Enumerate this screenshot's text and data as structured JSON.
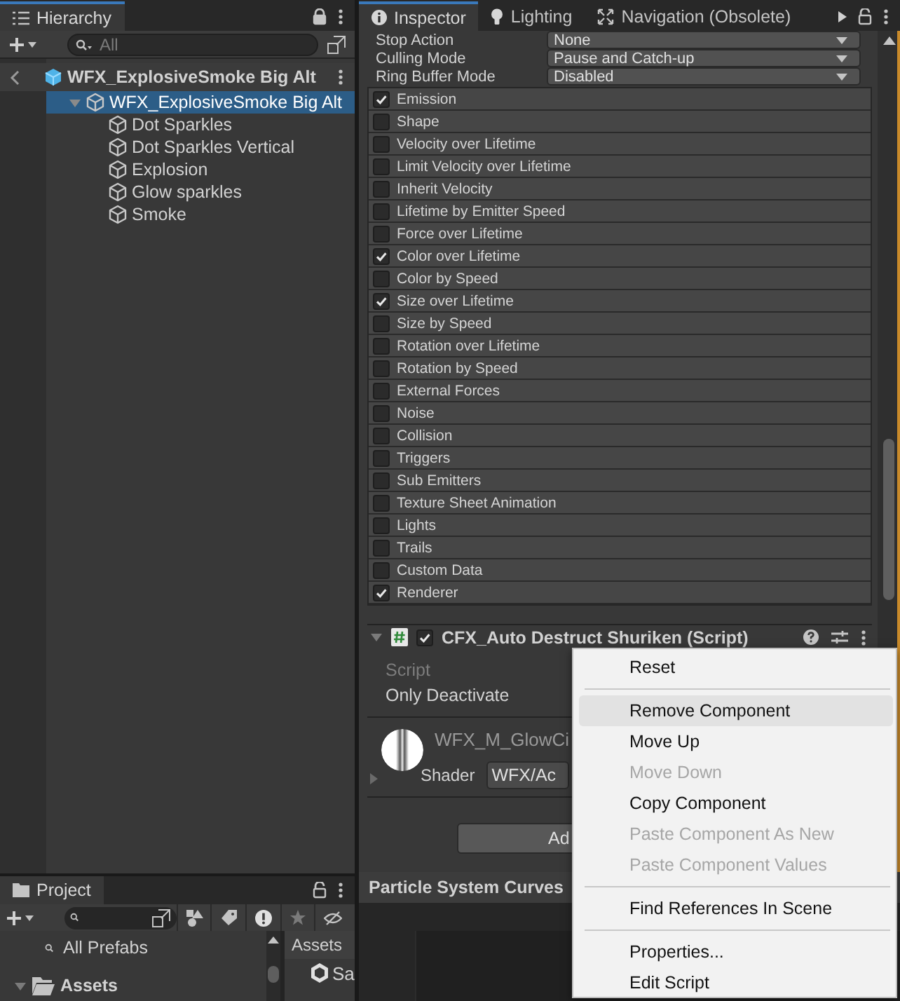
{
  "hierarchy": {
    "title": "Hierarchy",
    "search": {
      "placeholder": "All"
    },
    "scene": "WFX_ExplosiveSmoke Big Alt",
    "tree": [
      {
        "label": "WFX_ExplosiveSmoke Big Alt",
        "selected": true,
        "expanded": true,
        "children": [
          {
            "label": "Dot Sparkles",
            "selected": false
          },
          {
            "label": "Dot Sparkles Vertical",
            "selected": false
          },
          {
            "label": "Explosion",
            "selected": false
          },
          {
            "label": "Glow sparkles",
            "selected": false
          },
          {
            "label": "Smoke",
            "selected": false
          }
        ]
      }
    ]
  },
  "inspector": {
    "tabs": [
      {
        "label": "Inspector",
        "selected": true,
        "kind": "info"
      },
      {
        "label": "Lighting",
        "selected": false,
        "kind": "bulb"
      },
      {
        "label": "Navigation (Obsolete)",
        "selected": false,
        "kind": "nav"
      }
    ],
    "fields": [
      {
        "label": "Stop Action",
        "value": "None"
      },
      {
        "label": "Culling Mode",
        "value": "Pause and Catch-up"
      },
      {
        "label": "Ring Buffer Mode",
        "value": "Disabled"
      }
    ],
    "modules": [
      {
        "label": "Emission",
        "checked": true
      },
      {
        "label": "Shape",
        "checked": false
      },
      {
        "label": "Velocity over Lifetime",
        "checked": false
      },
      {
        "label": "Limit Velocity over Lifetime",
        "checked": false
      },
      {
        "label": "Inherit Velocity",
        "checked": false
      },
      {
        "label": "Lifetime by Emitter Speed",
        "checked": false
      },
      {
        "label": "Force over Lifetime",
        "checked": false
      },
      {
        "label": "Color over Lifetime",
        "checked": true
      },
      {
        "label": "Color by Speed",
        "checked": false
      },
      {
        "label": "Size over Lifetime",
        "checked": true
      },
      {
        "label": "Size by Speed",
        "checked": false
      },
      {
        "label": "Rotation over Lifetime",
        "checked": false
      },
      {
        "label": "Rotation by Speed",
        "checked": false
      },
      {
        "label": "External Forces",
        "checked": false
      },
      {
        "label": "Noise",
        "checked": false
      },
      {
        "label": "Collision",
        "checked": false
      },
      {
        "label": "Triggers",
        "checked": false
      },
      {
        "label": "Sub Emitters",
        "checked": false
      },
      {
        "label": "Texture Sheet Animation",
        "checked": false
      },
      {
        "label": "Lights",
        "checked": false
      },
      {
        "label": "Trails",
        "checked": false
      },
      {
        "label": "Custom Data",
        "checked": false
      },
      {
        "label": "Renderer",
        "checked": true
      }
    ],
    "component": {
      "title": "CFX_Auto Destruct Shuriken (Script)",
      "enabled": true,
      "expanded": true,
      "fields": [
        {
          "label": "Script",
          "disabled": true
        },
        {
          "label": "Only Deactivate",
          "disabled": false
        }
      ]
    },
    "material": {
      "name": "WFX_M_GlowCi",
      "shader_label": "Shader",
      "shader": "WFX/Ac"
    },
    "add_button": "Ad",
    "curves_title": "Particle System Curves"
  },
  "project": {
    "title": "Project",
    "favorites": [
      {
        "label": "All Prefabs"
      }
    ],
    "folders": [
      {
        "label": "Assets",
        "expanded": true
      }
    ],
    "breadcrumb": "Assets",
    "items": [
      {
        "label": "Sa"
      }
    ]
  },
  "context_menu": [
    {
      "kind": "item",
      "label": "Reset",
      "disabled": false,
      "selected": false
    },
    {
      "kind": "separator"
    },
    {
      "kind": "item",
      "label": "Remove Component",
      "disabled": false,
      "selected": true
    },
    {
      "kind": "item",
      "label": "Move Up",
      "disabled": false,
      "selected": false
    },
    {
      "kind": "item",
      "label": "Move Down",
      "disabled": true,
      "selected": false
    },
    {
      "kind": "item",
      "label": "Copy Component",
      "disabled": false,
      "selected": false
    },
    {
      "kind": "item",
      "label": "Paste Component As New",
      "disabled": true,
      "selected": false
    },
    {
      "kind": "item",
      "label": "Paste Component Values",
      "disabled": true,
      "selected": false
    },
    {
      "kind": "separator"
    },
    {
      "kind": "item",
      "label": "Find References In Scene",
      "disabled": false,
      "selected": false
    },
    {
      "kind": "separator"
    },
    {
      "kind": "item",
      "label": "Properties...",
      "disabled": false,
      "selected": false
    },
    {
      "kind": "item",
      "label": "Edit Script",
      "disabled": false,
      "selected": false
    }
  ]
}
